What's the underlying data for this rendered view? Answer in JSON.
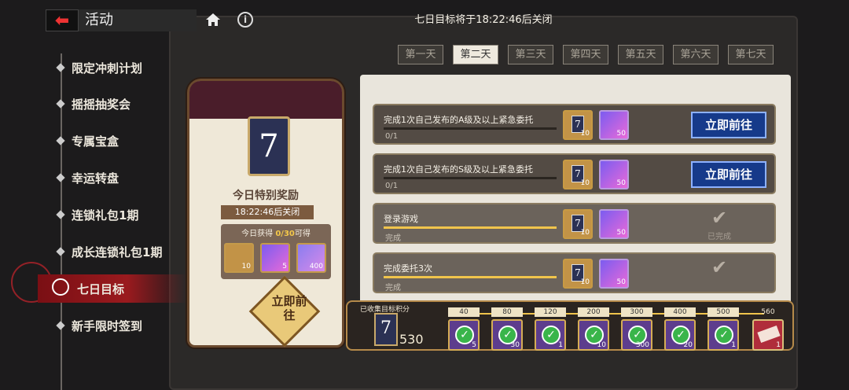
{
  "header": {
    "title": "活动",
    "countdown": "七日目标将于18:22:46后关闭"
  },
  "sidebar": {
    "items": [
      {
        "label": "限定冲刺计划"
      },
      {
        "label": "摇摇抽奖会"
      },
      {
        "label": "专属宝盒"
      },
      {
        "label": "幸运转盘"
      },
      {
        "label": "连锁礼包1期"
      },
      {
        "label": "成长连锁礼包1期"
      },
      {
        "label": "七日目标",
        "active": true
      },
      {
        "label": "新手限时签到"
      }
    ]
  },
  "reward_tag": {
    "card_number": "7",
    "title": "今日特别奖励",
    "timer": "18:22:46后关闭",
    "today_label_pre": "今日获得",
    "today_progress": "0/30",
    "today_label_post": "可得",
    "items": [
      {
        "icon": "card-icon",
        "count": "10"
      },
      {
        "icon": "ticket-icon",
        "count": "5"
      },
      {
        "icon": "gem-icon",
        "count": "400"
      }
    ],
    "go_label": "立即前往"
  },
  "tabs": [
    "第一天",
    "第二天",
    "第三天",
    "第四天",
    "第五天",
    "第六天",
    "第七天"
  ],
  "active_tab": 1,
  "tasks": [
    {
      "text": "完成1次自己发布的A级及以上紧急委托",
      "progress": "0/1",
      "fill": 0,
      "rewards": [
        "10",
        "50"
      ],
      "action": "立即前往",
      "done": false
    },
    {
      "text": "完成1次自己发布的S级及以上紧急委托",
      "progress": "0/1",
      "fill": 0,
      "rewards": [
        "10",
        "50"
      ],
      "action": "立即前往",
      "done": false
    },
    {
      "text": "登录游戏",
      "progress": "完成",
      "fill": 1,
      "rewards": [
        "10",
        "50"
      ],
      "action": "已完成",
      "done": true
    },
    {
      "text": "完成委托3次",
      "progress": "完成",
      "fill": 1,
      "rewards": [
        "10",
        "50"
      ],
      "action": "",
      "done": true
    }
  ],
  "points": {
    "label": "已收集目标积分",
    "card_number": "7",
    "value": "530",
    "milestones": [
      {
        "value": "40",
        "count": "5",
        "claimed": true
      },
      {
        "value": "80",
        "count": "30",
        "claimed": true
      },
      {
        "value": "120",
        "count": "1",
        "claimed": true
      },
      {
        "value": "200",
        "count": "10",
        "claimed": true
      },
      {
        "value": "300",
        "count": "300",
        "claimed": true
      },
      {
        "value": "400",
        "count": "20",
        "claimed": true
      },
      {
        "value": "500",
        "count": "1",
        "claimed": true
      },
      {
        "value": "560",
        "count": "1",
        "claimed": false
      }
    ]
  },
  "colors": {
    "accent": "#9a1a1e",
    "button": "#163a8a",
    "gold": "#f0c44c"
  }
}
